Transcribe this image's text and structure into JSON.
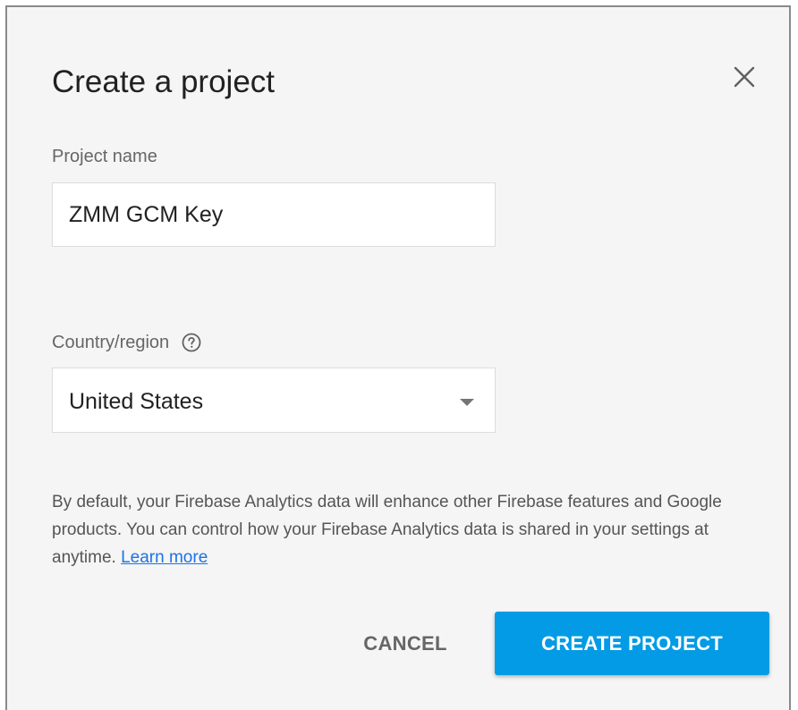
{
  "dialog": {
    "title": "Create a project",
    "close_icon": "close-icon"
  },
  "project_name": {
    "label": "Project name",
    "value": "ZMM GCM Key"
  },
  "country": {
    "label": "Country/region",
    "help_icon": "help-circle-icon",
    "selected": "United States",
    "dropdown_icon": "dropdown-arrow-icon"
  },
  "disclaimer": {
    "text": "By default, your Firebase Analytics data will enhance other Firebase features and Google products. You can control how your Firebase Analytics data is shared in your settings at anytime.",
    "link_text": "Learn more"
  },
  "actions": {
    "cancel_label": "CANCEL",
    "create_label": "CREATE PROJECT"
  },
  "colors": {
    "primary": "#039be5",
    "link": "#1a73e8",
    "dialog_background": "#f5f5f5"
  }
}
